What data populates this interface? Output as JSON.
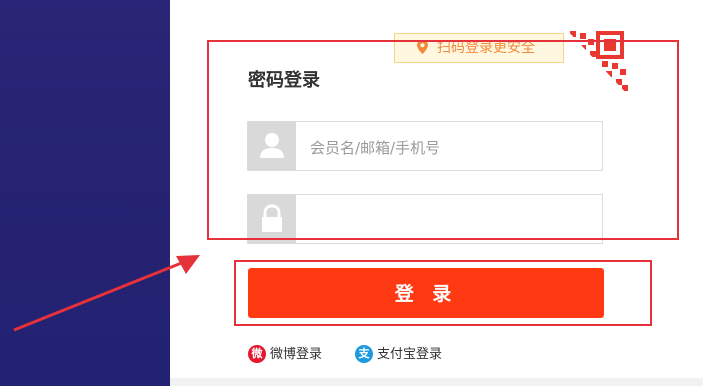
{
  "login": {
    "title": "密码登录",
    "qr_tip": "扫码登录更安全",
    "username_placeholder": "会员名/邮箱/手机号",
    "password_value": "",
    "submit_label": "登 录",
    "social": {
      "weibo_label": "微博登录",
      "weibo_icon_char": "微",
      "alipay_label": "支付宝登录",
      "alipay_icon_char": "支"
    }
  },
  "colors": {
    "left_panel": "#242271",
    "accent_button": "#ff3a13",
    "annotation_red": "#e5313a",
    "tip_text": "#f28a3a"
  },
  "icons": [
    "location-pin-icon",
    "qr-code-icon",
    "user-icon",
    "lock-icon",
    "weibo-icon",
    "alipay-icon",
    "annotation-arrow"
  ]
}
